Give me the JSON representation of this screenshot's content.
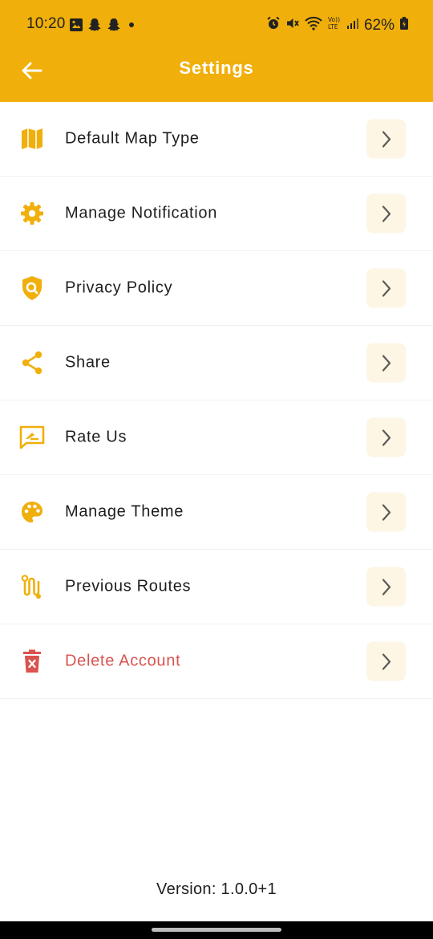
{
  "status_bar": {
    "time": "10:20",
    "battery": "62%",
    "left_icons": [
      "gallery-icon",
      "snapchat-icon",
      "snapchat-icon",
      "dot-icon"
    ],
    "right_icons": [
      "alarm-icon",
      "mute-icon",
      "wifi-icon",
      "volte-icon",
      "signal-icon",
      "battery-icon"
    ]
  },
  "header": {
    "title": "Settings",
    "background": "#F0AF0A"
  },
  "menu": [
    {
      "label": "Default Map Type",
      "icon": "map-icon"
    },
    {
      "label": "Manage Notification",
      "icon": "gear-icon"
    },
    {
      "label": "Privacy Policy",
      "icon": "privacy-shield-icon"
    },
    {
      "label": "Share",
      "icon": "share-icon"
    },
    {
      "label": "Rate Us",
      "icon": "rate-icon"
    },
    {
      "label": "Manage Theme",
      "icon": "palette-icon"
    },
    {
      "label": "Previous Routes",
      "icon": "route-icon"
    },
    {
      "label": "Delete Account",
      "icon": "delete-icon"
    }
  ],
  "colors": {
    "accent": "#F0AF0A",
    "danger": "#D9534F",
    "chevron_bg": "#FDF6E4"
  },
  "footer": {
    "version": "Version: 1.0.0+1"
  }
}
